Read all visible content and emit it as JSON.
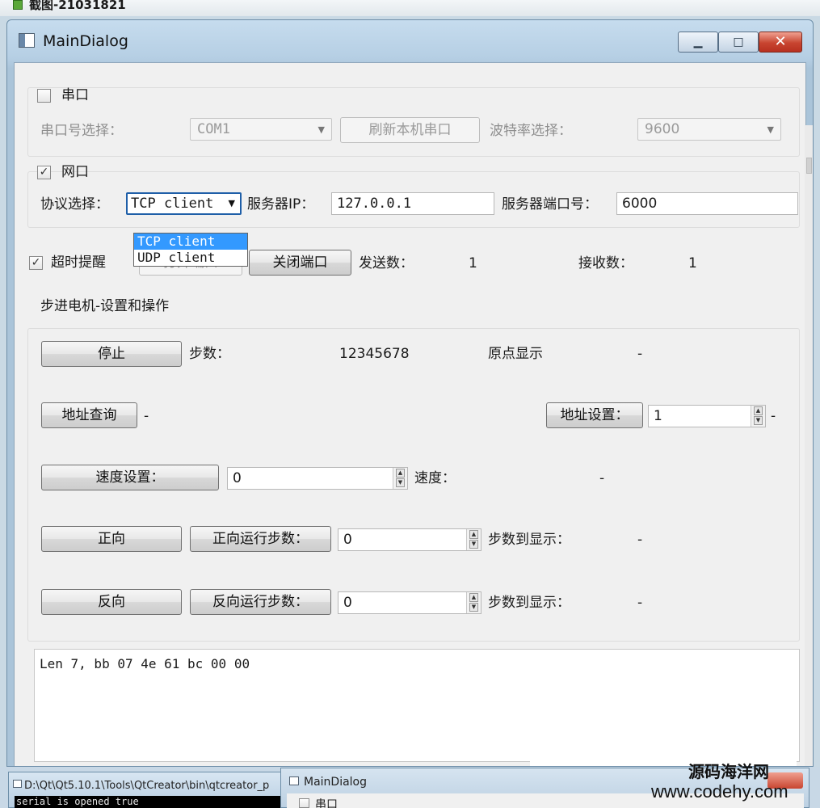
{
  "outer": {
    "title": "截图-21031821"
  },
  "window": {
    "title": "MainDialog",
    "minimize_glyph": "▁",
    "maximize_glyph": "□",
    "close_glyph": "✕"
  },
  "serial_group": {
    "checkbox_label": "串口",
    "checked": false,
    "port_label": "串口号选择：",
    "port_value": "COM1",
    "refresh_button": "刷新本机串口",
    "baud_label": "波特率选择：",
    "baud_value": "9600"
  },
  "network_group": {
    "checkbox_label": "网口",
    "checked": true,
    "protocol_label": "协议选择：",
    "protocol_value": "TCP client",
    "protocol_options": [
      "TCP client",
      "UDP client"
    ],
    "server_ip_label": "服务器IP：",
    "server_ip_value": "127.0.0.1",
    "server_port_label": "服务器端口号：",
    "server_port_value": "6000"
  },
  "control_row": {
    "timeout_label": "超时提醒",
    "timeout_checked": true,
    "open_button": "打开端口",
    "close_button": "关闭端口",
    "send_label": "发送数：",
    "send_value": "1",
    "recv_label": "接收数：",
    "recv_value": "1"
  },
  "motor_group": {
    "title": "步进电机-设置和操作",
    "stop_button": "停止",
    "steps_label": "步数：",
    "steps_value": "12345678",
    "origin_label": "原点显示",
    "origin_value": "-",
    "addr_query_button": "地址查询",
    "addr_query_value": "-",
    "addr_set_button": "地址设置：",
    "addr_set_value": "1",
    "addr_set_result": "-",
    "speed_set_button": "速度设置：",
    "speed_set_value": "0",
    "speed_label": "速度：",
    "speed_value": "-",
    "forward_button": "正向",
    "forward_steps_button": "正向运行步数：",
    "forward_steps_value": "0",
    "forward_display_label": "步数到显示：",
    "forward_display_value": "-",
    "reverse_button": "反向",
    "reverse_steps_button": "反向运行步数：",
    "reverse_steps_value": "0",
    "reverse_display_label": "步数到显示：",
    "reverse_display_value": "-"
  },
  "log": {
    "text": "Len 7, bb 07 4e 61 bc 00 00"
  },
  "taskbar": {
    "console_title": "D:\\Qt\\Qt5.10.1\\Tools\\QtCreator\\bin\\qtcreator_p",
    "console_text": "serial is opened true",
    "second_title": "MainDialog",
    "second_checkbox_label": "串口"
  },
  "brand": {
    "line1": "源码海洋网",
    "line2": "www.codehy.com"
  },
  "colors": {
    "title_bar": "#b6cfe4",
    "client_bg": "#f0f0f0",
    "close_button": "#c84530",
    "selection": "#3399ff"
  }
}
